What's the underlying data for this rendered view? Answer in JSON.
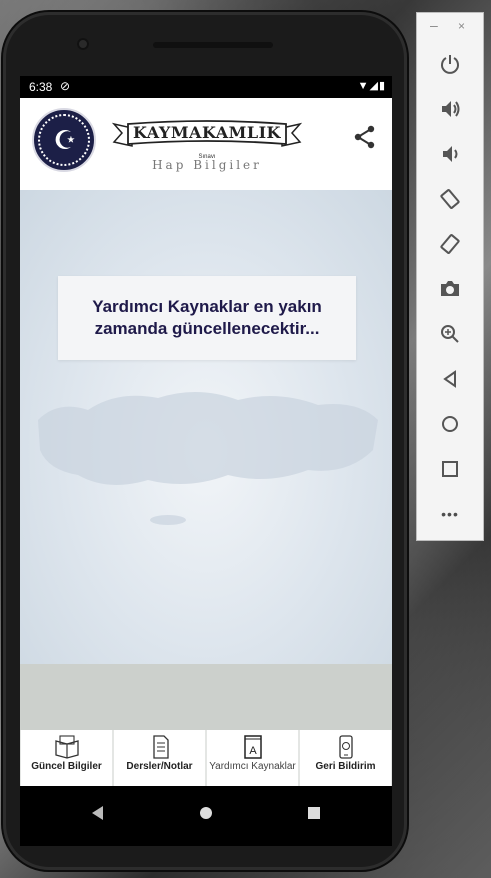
{
  "status_bar": {
    "time": "6:38",
    "sync_icon": "sync-icon",
    "right_icons": "▼◢▮"
  },
  "app_bar": {
    "logo_title": "KAYMAKAMLIK",
    "logo_small": "Sınavı",
    "logo_subtitle": "Hap Bilgiler",
    "share_icon": "share-icon",
    "emblem_symbol": "☪"
  },
  "content": {
    "message": "Yardımcı Kaynaklar en yakın zamanda güncellenecektir..."
  },
  "bottom_nav": {
    "items": [
      {
        "label": "Güncel Bilgiler",
        "icon": "book-open-icon"
      },
      {
        "label": "Dersler/Notlar",
        "icon": "document-icon"
      },
      {
        "label": "Yardımcı Kaynaklar",
        "icon": "book-a-icon"
      },
      {
        "label": "Geri Bildirim",
        "icon": "phone-feedback-icon"
      }
    ]
  },
  "toolbar": {
    "minimize": "–",
    "close": "×",
    "buttons": [
      "power-icon",
      "volume-up-icon",
      "volume-down-icon",
      "rotate-left-icon",
      "rotate-right-icon",
      "camera-icon",
      "zoom-icon",
      "back-icon",
      "home-icon",
      "overview-icon",
      "more-icon"
    ],
    "more_label": "•••"
  },
  "colors": {
    "accent_text": "#1f1a4a",
    "emblem": "#1c1f47"
  }
}
